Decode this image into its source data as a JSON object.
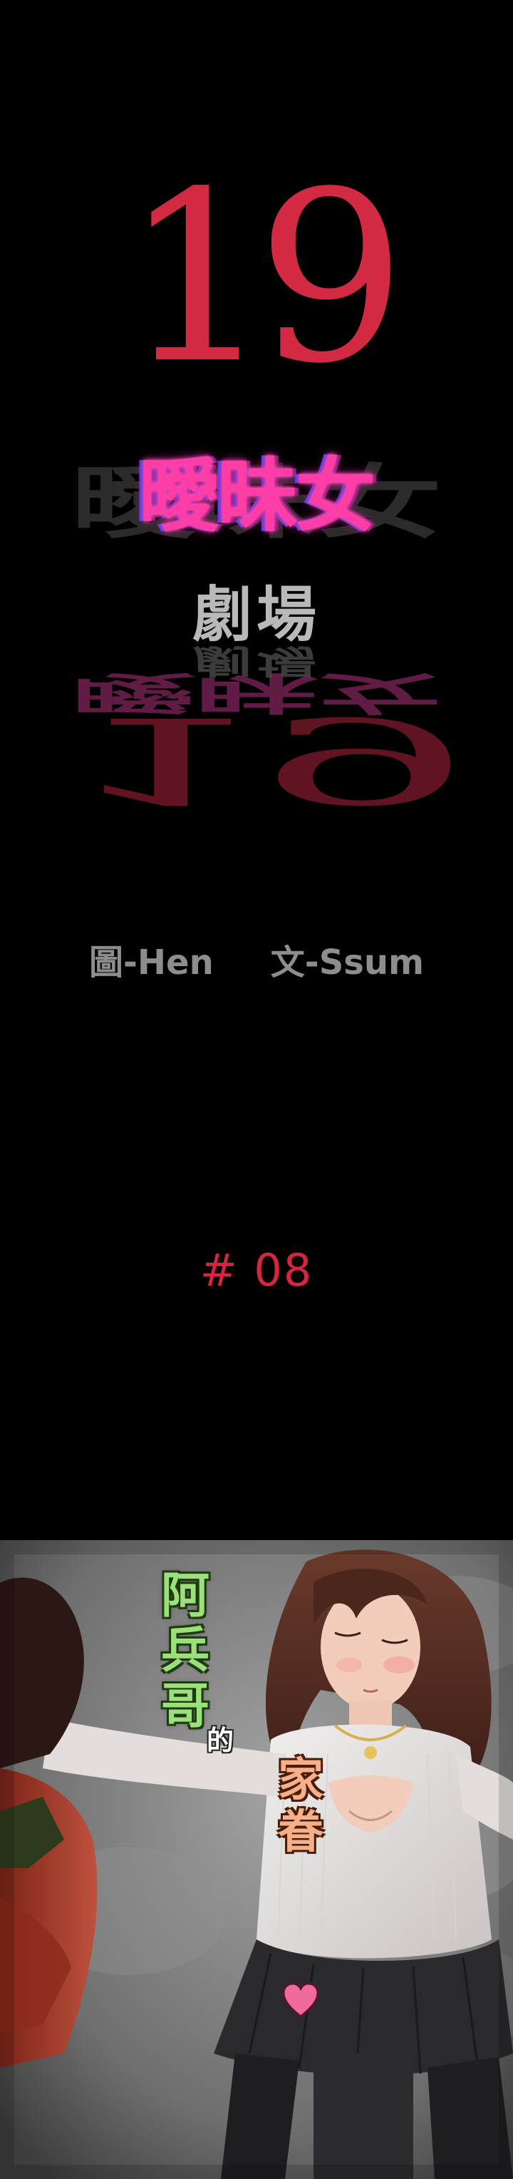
{
  "logo": {
    "number": "19",
    "title": "曖昧女",
    "subtitle": "劇場",
    "colors": {
      "number": "#d32a43",
      "title": "#ff3da6",
      "subtitle": "#b9b9b9"
    }
  },
  "credits": {
    "art": "圖-Hen",
    "story": "文-Ssum"
  },
  "episode": {
    "label": "# 08",
    "color": "#d6253f"
  },
  "cover_text": {
    "line1": [
      "阿",
      "兵",
      "哥"
    ],
    "particle": "的",
    "line2": [
      "家",
      "眷"
    ],
    "heart_icon": "heart-icon",
    "colors": {
      "line1": "#9be07a",
      "line2": "#f5b08a",
      "heart": "#f06a9a"
    }
  }
}
